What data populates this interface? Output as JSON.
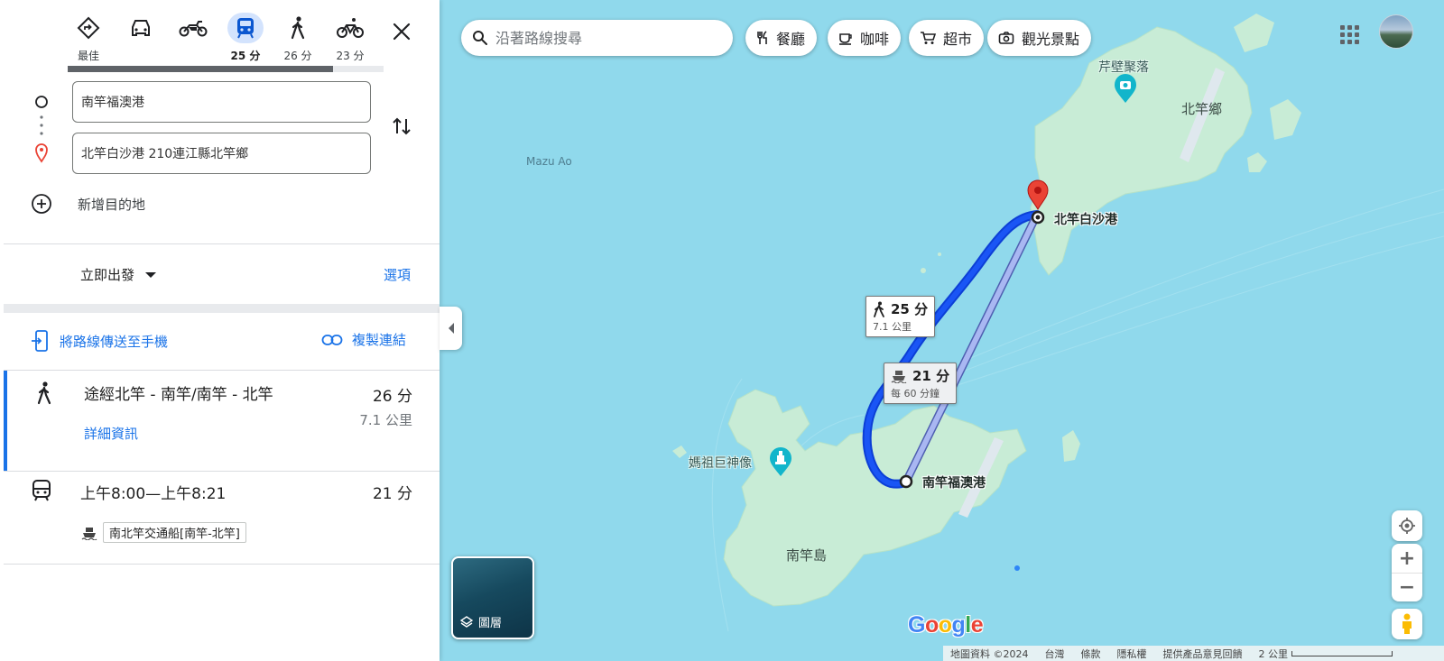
{
  "directions": {
    "modes": [
      {
        "key": "best",
        "label": "最佳"
      },
      {
        "key": "drive",
        "label": ""
      },
      {
        "key": "motorcycle",
        "label": ""
      },
      {
        "key": "transit",
        "label": "25 分"
      },
      {
        "key": "walk",
        "label": "26 分"
      },
      {
        "key": "bicycle",
        "label": "23 分"
      }
    ],
    "active_mode": "transit",
    "origin": "南竿福澳港",
    "destination": "北竿白沙港 210連江縣北竿鄉",
    "add_destination": "新增目的地",
    "depart_label": "立即出發",
    "options_label": "選項",
    "send_to_phone": "將路線傳送至手機",
    "copy_link": "複製連結"
  },
  "routes": [
    {
      "title": "途經北竿 - 南竿/南竿 - 北竿",
      "time": "26 分",
      "distance": "7.1 公里",
      "details": "詳細資訊"
    },
    {
      "title": "上午8:00—上午8:21",
      "time": "21 分",
      "ferry": "南北竿交通船[南竿-北竿]"
    }
  ],
  "map": {
    "search_placeholder": "沿著路線搜尋",
    "chips": [
      "餐廳",
      "咖啡",
      "超市",
      "觀光景點"
    ],
    "labels": {
      "sea": "Mazu Ao",
      "beigan_township": "北竿鄉",
      "qinbi": "芹壁聚落",
      "nangan_island": "南竿島",
      "mazu_statue": "媽祖巨神像",
      "origin_port": "南竿福澳港",
      "dest_port": "北竿白沙港"
    },
    "walk_tag": {
      "time": "25 分",
      "distance": "7.1 公里"
    },
    "ferry_tag": {
      "time": "21 分",
      "frequency": "每 60 分鐘"
    },
    "layers_label": "圖層",
    "footer": {
      "data": "地圖資料 ©2024",
      "region": "台灣",
      "terms": "條款",
      "privacy": "隱私權",
      "feedback": "提供產品意見回饋",
      "scale": "2 公里"
    },
    "logo": "Google"
  },
  "colors": {
    "accent": "#1a73e8",
    "route_blue": "#1a44f0",
    "land": "#c8ecd6",
    "water": "#90d9ec",
    "pin_red": "#ea4335"
  }
}
